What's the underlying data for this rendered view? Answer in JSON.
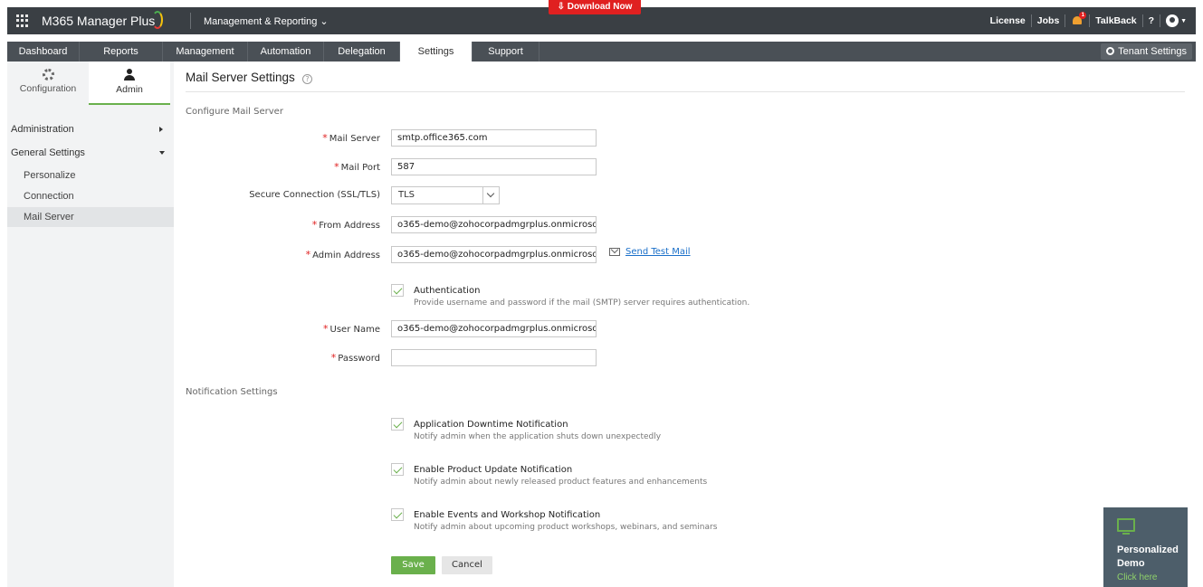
{
  "header": {
    "brand": "M365 Manager Plus",
    "module_menu": "Management & Reporting ⌄",
    "download_label": "⇩ Download Now",
    "links": {
      "license": "License",
      "jobs": "Jobs",
      "talkback": "TalkBack",
      "help": "?"
    },
    "bell_count": "1"
  },
  "nav": {
    "tabs": [
      "Dashboard",
      "Reports",
      "Management",
      "Automation",
      "Delegation",
      "Settings",
      "Support"
    ],
    "active": "Settings",
    "tenant_settings": "Tenant Settings"
  },
  "sidebar": {
    "tabs": {
      "configuration": "Configuration",
      "admin": "Admin"
    },
    "administration": "Administration",
    "general_settings": "General Settings",
    "items": [
      "Personalize",
      "Connection",
      "Mail Server"
    ],
    "selected": "Mail Server"
  },
  "main": {
    "title": "Mail Server Settings",
    "help": "?",
    "configure_section": "Configure Mail Server",
    "fields": {
      "mail_server": {
        "label": "Mail Server",
        "value": "smtp.office365.com"
      },
      "mail_port": {
        "label": "Mail Port",
        "value": "587"
      },
      "secure_connection": {
        "label": "Secure Connection (SSL/TLS)",
        "value": "TLS"
      },
      "from_address": {
        "label": "From Address",
        "value": "o365-demo@zohocorpadmgrplus.onmicroso"
      },
      "admin_address": {
        "label": "Admin Address",
        "value": "o365-demo@zohocorpadmgrplus.onmicroso"
      },
      "user_name": {
        "label": "User Name",
        "value": "o365-demo@zohocorpadmgrplus.onmicroso"
      },
      "password": {
        "label": "Password",
        "value": ""
      }
    },
    "send_test_mail": "Send Test Mail",
    "authentication": {
      "title": "Authentication",
      "desc": "Provide username and password if the mail (SMTP) server requires authentication.",
      "checked": true
    },
    "notification_section": "Notification Settings",
    "notifications": [
      {
        "title": "Application Downtime Notification",
        "desc": "Notify admin when the application shuts down unexpectedly",
        "checked": true
      },
      {
        "title": "Enable Product Update Notification",
        "desc": "Notify admin about newly released product features and enhancements",
        "checked": true
      },
      {
        "title": "Enable Events and Workshop Notification",
        "desc": "Notify admin about upcoming product workshops, webinars, and seminars",
        "checked": true
      }
    ],
    "save": "Save",
    "cancel": "Cancel"
  },
  "demo": {
    "title": "Personalized Demo",
    "link": "Click here"
  },
  "colors": {
    "topbar": "#3a3f44",
    "navbar": "#4a5056",
    "accent_green": "#6ab04c",
    "download_red": "#e02020",
    "link_blue": "#1a6fc9"
  }
}
